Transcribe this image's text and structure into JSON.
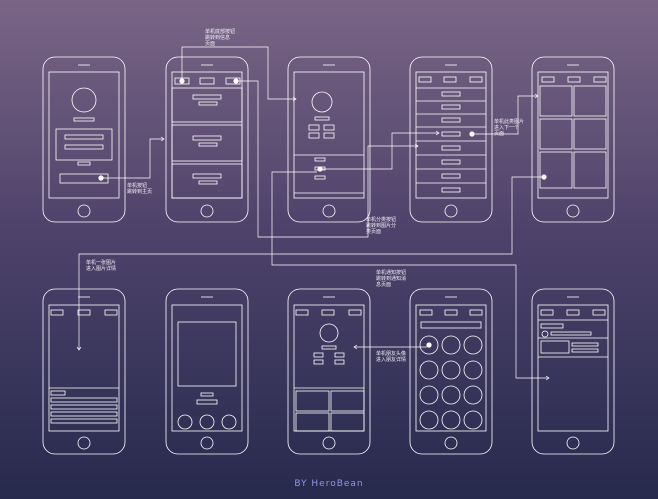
{
  "annotations": {
    "a1": [
      "单机底部按钮",
      "跳转到信息",
      "页面"
    ],
    "a2": [
      "单机按钮",
      "跳转到主页"
    ],
    "a3": [
      "单机此类图片",
      "进入下一个",
      "页面"
    ],
    "a4": [
      "单机分类按钮",
      "跳转到图片分",
      "类页面"
    ],
    "a5": [
      "单机一张图片",
      "进入图片详情"
    ],
    "a6": [
      "单机通知按钮",
      "跳转到通知消",
      "息页面"
    ],
    "a7": [
      "单机朋友头像",
      "进入朋友详情"
    ]
  },
  "footer": {
    "credit": "BY HeroBean"
  },
  "colors": {
    "background_top": "#7a6586",
    "background_bottom": "#272a4d",
    "wire": "#ffffff",
    "credit": "#8e97e6"
  }
}
